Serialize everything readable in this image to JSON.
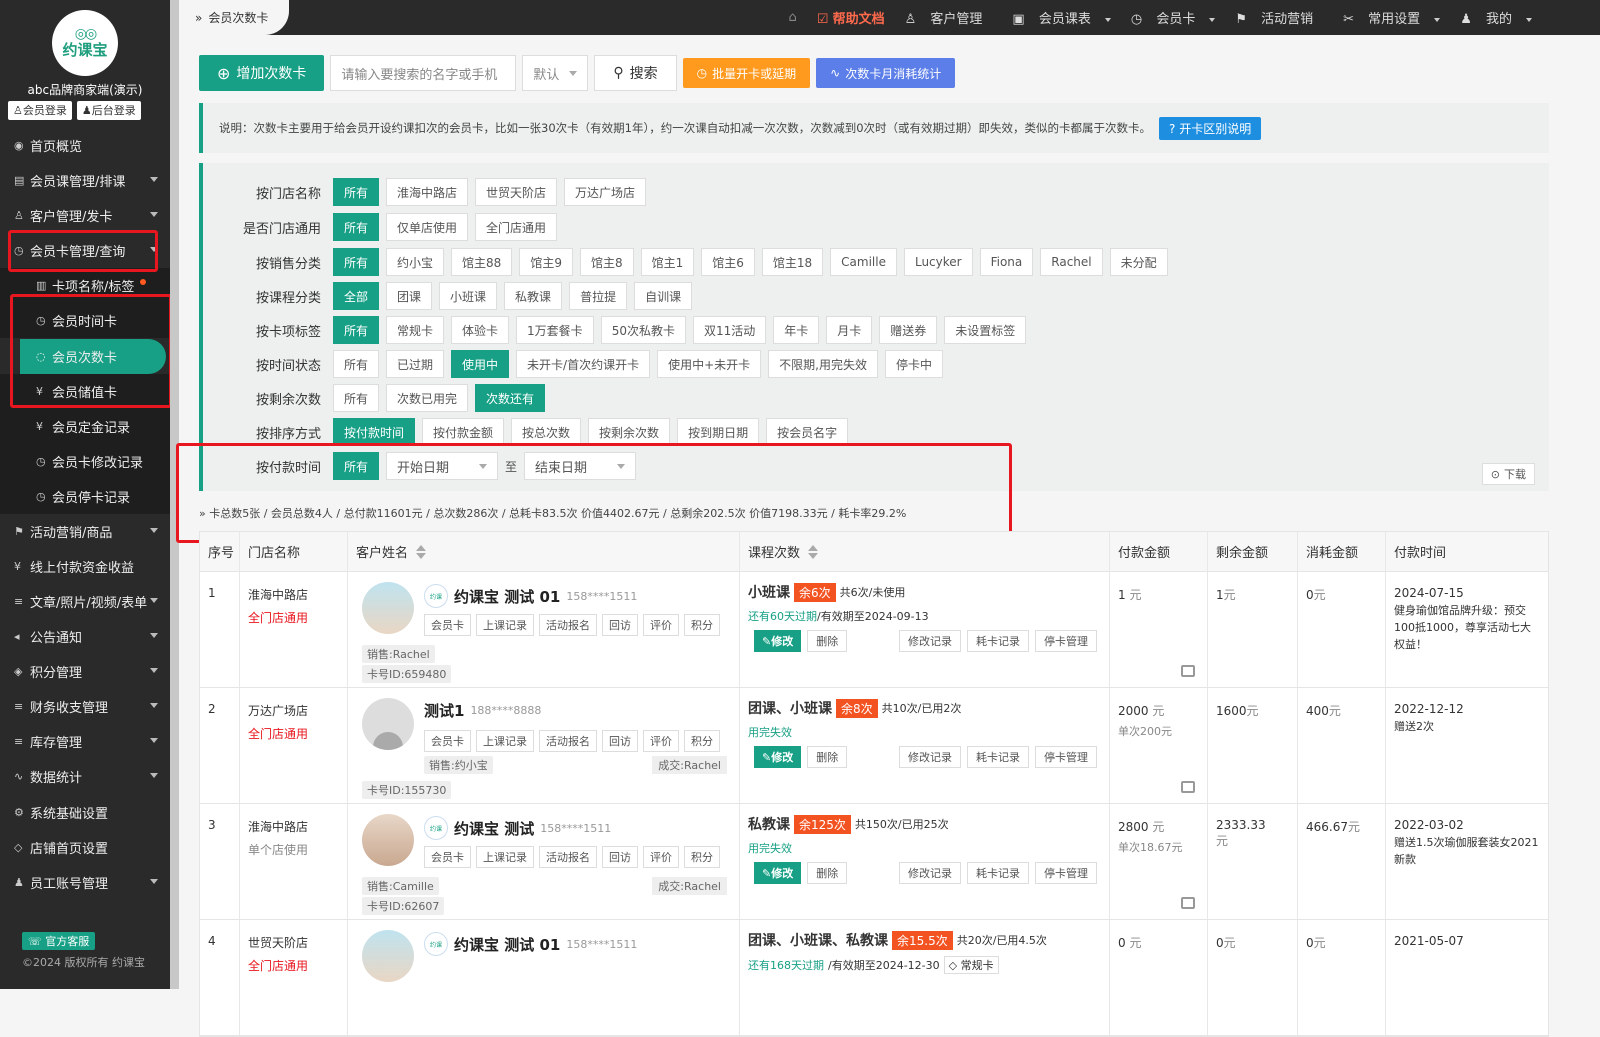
{
  "sidebar": {
    "logo_text": "约课宝",
    "brand": "abc品牌商家端(演示)",
    "member_login": "会员登录",
    "admin_login": "后台登录",
    "items": [
      {
        "label": "首页概览",
        "icon": "◉"
      },
      {
        "label": "会员课管理/排课",
        "icon": "▤"
      },
      {
        "label": "客户管理/发卡",
        "icon": "♙"
      },
      {
        "label": "会员卡管理/查询",
        "icon": "◷"
      },
      {
        "label": "卡项名称/标签",
        "icon": "▥"
      },
      {
        "label": "会员时间卡",
        "icon": "◷"
      },
      {
        "label": "会员次数卡",
        "icon": "◌"
      },
      {
        "label": "会员储值卡",
        "icon": "¥"
      },
      {
        "label": "会员定金记录",
        "icon": "¥"
      },
      {
        "label": "会员卡修改记录",
        "icon": "◷"
      },
      {
        "label": "会员停卡记录",
        "icon": "◷"
      },
      {
        "label": "活动营销/商品",
        "icon": "⚑"
      },
      {
        "label": "线上付款资金收益",
        "icon": "¥"
      },
      {
        "label": "文章/照片/视频/表单",
        "icon": "≡"
      },
      {
        "label": "公告通知",
        "icon": "◂"
      },
      {
        "label": "积分管理",
        "icon": "◈"
      },
      {
        "label": "财务收支管理",
        "icon": "≡"
      },
      {
        "label": "库存管理",
        "icon": "≡"
      },
      {
        "label": "数据统计",
        "icon": "∿"
      },
      {
        "label": "系统基础设置",
        "icon": "⚙"
      },
      {
        "label": "店铺首页设置",
        "icon": "◇"
      },
      {
        "label": "员工账号管理",
        "icon": "♟"
      }
    ],
    "service": "官方客服",
    "copyright": "©2024 版权所有 约课宝"
  },
  "topbar": {
    "breadcrumb": "会员次数卡",
    "home_icon": "⌂",
    "nav": [
      "帮助文档",
      "客户管理",
      "会员课表",
      "会员卡",
      "活动营销",
      "常用设置",
      "我的"
    ]
  },
  "toolbar": {
    "add_label": "增加次数卡",
    "search_placeholder": "请输入要搜索的名字或手机",
    "sort_default": "默认",
    "search_label": "搜索",
    "batch_label": "批量开卡或延期",
    "stats_label": "次数卡月消耗统计"
  },
  "notice": {
    "text": "说明：次数卡主要用于给会员开设约课扣次的会员卡，比如一张30次卡（有效期1年），约一次课自动扣减一次次数，次数减到0次时（或有效期过期）即失效，类似的卡都属于次数卡。",
    "help_btn": "开卡区别说明"
  },
  "filters": [
    {
      "label": "按门店名称",
      "options": [
        "所有",
        "淮海中路店",
        "世贸天阶店",
        "万达广场店"
      ],
      "selected": 0
    },
    {
      "label": "是否门店通用",
      "options": [
        "所有",
        "仅单店使用",
        "全门店通用"
      ],
      "selected": 0
    },
    {
      "label": "按销售分类",
      "options": [
        "所有",
        "约小宝",
        "馆主88",
        "馆主9",
        "馆主8",
        "馆主1",
        "馆主6",
        "馆主18",
        "Camille",
        "Lucyker",
        "Fiona",
        "Rachel",
        "未分配"
      ],
      "selected": 0
    },
    {
      "label": "按课程分类",
      "options": [
        "全部",
        "团课",
        "小班课",
        "私教课",
        "普拉提",
        "自训课"
      ],
      "selected": 0
    },
    {
      "label": "按卡项标签",
      "options": [
        "所有",
        "常规卡",
        "体验卡",
        "1万套餐卡",
        "50次私教卡",
        "双11活动",
        "年卡",
        "月卡",
        "赠送券",
        "未设置标签"
      ],
      "selected": 0
    },
    {
      "label": "按时间状态",
      "options": [
        "所有",
        "已过期",
        "使用中",
        "未开卡/首次约课开卡",
        "使用中+未开卡",
        "不限期,用完失效",
        "停卡中"
      ],
      "selected": 2
    },
    {
      "label": "按剩余次数",
      "options": [
        "所有",
        "次数已用完",
        "次数还有"
      ],
      "selected": 2
    },
    {
      "label": "按排序方式",
      "options": [
        "按付款时间",
        "按付款金额",
        "按总次数",
        "按剩余次数",
        "按到期日期",
        "按会员名字"
      ],
      "selected": 0
    }
  ],
  "pay_time": {
    "label": "按付款时间",
    "all": "所有",
    "start": "开始日期",
    "to": "至",
    "end": "结束日期"
  },
  "download_label": "下载",
  "summary": "卡总数5张 / 会员总数4人 / 总付款11601元 / 总次数286次 / 总耗卡83.5次 价值4402.67元 / 总剩余202.5次 价值7198.33元 / 耗卡率29.2%",
  "table": {
    "headers": [
      "序号",
      "门店名称",
      "客户姓名",
      "课程次数",
      "付款金额",
      "剩余金额",
      "消耗金额",
      "付款时间"
    ],
    "actions": [
      "会员卡",
      "上课记录",
      "活动报名",
      "回访",
      "评价",
      "积分"
    ],
    "edit_label": "修改",
    "delete_label": "删除",
    "right_ops": [
      "修改记录",
      "耗卡记录",
      "停卡管理"
    ],
    "rows": [
      {
        "no": "1",
        "store": "淮海中路店",
        "scope": "全门店通用",
        "name": "约课宝 测试 01",
        "phone": "158****1511",
        "sales": "销售:Rachel",
        "deal": "",
        "card_id": "卡号ID:659480",
        "course": "小班课",
        "remain": "余6次",
        "count_info": "共6次/未使用",
        "validity": "还有60天过期",
        "validity_tail": "/有效期至2024-09-13",
        "pay": "1",
        "pay_unit": "元",
        "per": "",
        "left": "1",
        "left_unit": "元",
        "used": "0",
        "used_unit": "元",
        "date": "2024-07-15",
        "note": "健身瑜伽馆品牌升级：预交100抵1000，尊享活动七大权益！"
      },
      {
        "no": "2",
        "store": "万达广场店",
        "scope": "全门店通用",
        "name": "测试1",
        "phone": "188****8888",
        "sales": "销售:约小宝",
        "deal": "成交:Rachel",
        "card_id": "卡号ID:155730",
        "course": "团课、小班课",
        "remain": "余8次",
        "count_info": "共10次/已用2次",
        "validity": "用完失效",
        "validity_tail": "",
        "pay": "2000",
        "pay_unit": "元",
        "per": "单次200元",
        "left": "1600",
        "left_unit": "元",
        "used": "400",
        "used_unit": "元",
        "date": "2022-12-12",
        "note": "赠送2次"
      },
      {
        "no": "3",
        "store": "淮海中路店",
        "scope": "单个店使用",
        "name": "约课宝 测试",
        "phone": "158****1511",
        "sales": "销售:Camille",
        "deal": "成交:Rachel",
        "card_id": "卡号ID:62607",
        "course": "私教课",
        "remain": "余125次",
        "count_info": "共150次/已用25次",
        "validity": "用完失效",
        "validity_tail": "",
        "pay": "2800",
        "pay_unit": "元",
        "per": "单次18.67元",
        "left": "2333.33",
        "left_unit": "元",
        "used": "466.67",
        "used_unit": "元",
        "date": "2022-03-02",
        "note": "赠送1.5次瑜伽服套装女2021新款"
      },
      {
        "no": "4",
        "store": "世贸天阶店",
        "scope": "全门店通用",
        "name": "约课宝 测试 01",
        "phone": "158****1511",
        "sales": "",
        "deal": "",
        "card_id": "",
        "course": "团课、小班课、私教课",
        "remain": "余15.5次",
        "count_info": "共20次/已用4.5次",
        "validity": "还有168天过期",
        "validity_tail": "/有效期至2024-12-30",
        "tag": "常规卡",
        "pay": "0",
        "pay_unit": "元",
        "per": "",
        "left": "0",
        "left_unit": "元",
        "used": "0",
        "used_unit": "元",
        "date": "2021-05-07",
        "note": ""
      }
    ]
  }
}
